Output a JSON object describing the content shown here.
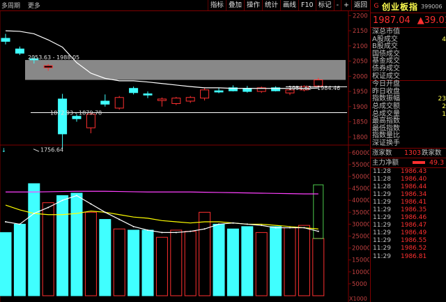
{
  "header": {
    "period_label": "多周期",
    "more_label": "更多",
    "toolbar": [
      "指标",
      "叠加",
      "操作",
      "统计",
      "画线",
      "F10",
      "标记",
      "-",
      "+",
      "返回"
    ]
  },
  "stock": {
    "market_flag": "G",
    "name": "创业板指",
    "code": "399006",
    "price": "1987.04",
    "change": "▲39.01"
  },
  "stats": [
    "深总市值",
    "A股成交",
    "B股成交",
    "国债成交",
    "基金成交",
    "债券成交",
    "权证成交",
    "今日开盘",
    "昨日收盘",
    "指数振幅",
    "总成交额",
    "总成交量",
    "最高指数",
    "最低指数",
    "指数量比",
    "深证换手"
  ],
  "stat_values": {
    "A股成交": "4",
    "指数振幅": "23",
    "总成交额": "2",
    "总成交量": "1"
  },
  "updown": {
    "up_label": "涨家数",
    "up_count": "1303",
    "down_label": "跌家数"
  },
  "mainflow": {
    "label": "主力净额",
    "value": "49.3"
  },
  "ticks": [
    {
      "t": "11:28",
      "p": "1986.43"
    },
    {
      "t": "11:28",
      "p": "1986.40"
    },
    {
      "t": "11:28",
      "p": "1986.44"
    },
    {
      "t": "11:29",
      "p": "1986.34"
    },
    {
      "t": "11:29",
      "p": "1986.41"
    },
    {
      "t": "11:29",
      "p": "1986.35"
    },
    {
      "t": "11:29",
      "p": "1986.46"
    },
    {
      "t": "11:29",
      "p": "1986.47"
    },
    {
      "t": "11:29",
      "p": "1986.49"
    },
    {
      "t": "11:29",
      "p": "1986.55"
    },
    {
      "t": "11:29",
      "p": "1986.52"
    },
    {
      "t": "11:29",
      "p": "1986.81"
    }
  ],
  "price_axis": {
    "ticks": [
      "2200",
      "2150",
      "2100",
      "2050",
      "2000",
      "1950",
      "1900",
      "1850",
      "1800"
    ],
    "values": [
      2200,
      2150,
      2100,
      2050,
      2000,
      1950,
      1900,
      1850,
      1800
    ]
  },
  "volume_axis": {
    "ticks": [
      "60000",
      "55000",
      "50000",
      "45000",
      "40000",
      "35000",
      "30000",
      "25000",
      "20000",
      "15000",
      "10000",
      "5000"
    ],
    "values": [
      60000,
      55000,
      50000,
      45000,
      40000,
      35000,
      30000,
      25000,
      20000,
      15000,
      10000,
      5000
    ],
    "unit": "X1000"
  },
  "annotations": {
    "high": "2053.63 - 1988.05",
    "mid1": "1872.93 - 1879.78",
    "mid2": "1954.62 - 1984.46",
    "low": "1756.64"
  },
  "chart_data": {
    "type": "candlestick",
    "ylim": [
      1780,
      2210
    ],
    "vol_ylim": [
      0,
      62000
    ],
    "colors": {
      "up": "#ff3030",
      "down": "#40ffff",
      "ma1": "#ffffff",
      "ma2": "#ffff00",
      "ma3": "#ff40ff",
      "band": "#a0a0a0"
    },
    "candles": [
      {
        "o": 2125,
        "h": 2140,
        "l": 2105,
        "c": 2115
      },
      {
        "o": 2090,
        "h": 2098,
        "l": 2070,
        "c": 2076
      },
      {
        "o": 2058,
        "h": 2066,
        "l": 2042,
        "c": 2054
      },
      {
        "o": 2028,
        "h": 2040,
        "l": 2018,
        "c": 2035
      },
      {
        "o": 1925,
        "h": 1942,
        "l": 1760,
        "c": 1810
      },
      {
        "o": 1868,
        "h": 1875,
        "l": 1850,
        "c": 1860
      },
      {
        "o": 1830,
        "h": 1880,
        "l": 1812,
        "c": 1875
      },
      {
        "o": 1918,
        "h": 1940,
        "l": 1900,
        "c": 1908
      },
      {
        "o": 1895,
        "h": 1935,
        "l": 1890,
        "c": 1930
      },
      {
        "o": 1960,
        "h": 1966,
        "l": 1940,
        "c": 1946
      },
      {
        "o": 1942,
        "h": 1950,
        "l": 1928,
        "c": 1938
      },
      {
        "o": 1920,
        "h": 1930,
        "l": 1900,
        "c": 1925
      },
      {
        "o": 1910,
        "h": 1932,
        "l": 1905,
        "c": 1928
      },
      {
        "o": 1918,
        "h": 1935,
        "l": 1912,
        "c": 1930
      },
      {
        "o": 1928,
        "h": 1962,
        "l": 1920,
        "c": 1955
      },
      {
        "o": 1952,
        "h": 1962,
        "l": 1944,
        "c": 1948
      },
      {
        "o": 1962,
        "h": 1970,
        "l": 1950,
        "c": 1952
      },
      {
        "o": 1960,
        "h": 1968,
        "l": 1946,
        "c": 1950
      },
      {
        "o": 1950,
        "h": 1966,
        "l": 1945,
        "c": 1962
      },
      {
        "o": 1962,
        "h": 1967,
        "l": 1950,
        "c": 1952
      },
      {
        "o": 1945,
        "h": 1960,
        "l": 1938,
        "c": 1955
      },
      {
        "o": 1955,
        "h": 1970,
        "l": 1950,
        "c": 1966
      },
      {
        "o": 1968,
        "h": 1995,
        "l": 1966,
        "c": 1988
      }
    ],
    "volumes": [
      26500,
      30000,
      47000,
      39000,
      42000,
      43000,
      35000,
      32000,
      28000,
      27500,
      27500,
      24500,
      27500,
      27000,
      35000,
      30000,
      28000,
      29000,
      26500,
      29000,
      28500,
      29500,
      24000
    ],
    "ma_price": [
      2150,
      2148,
      2140,
      2120,
      2096,
      2045,
      2010,
      1993,
      1985,
      1985,
      1981,
      1976,
      1971,
      1966,
      1962,
      1962,
      1960,
      1960,
      1960,
      1960,
      1960,
      1960,
      1961
    ],
    "vol_ma1": [
      31000,
      30000,
      34500,
      37000,
      40000,
      42000,
      38500,
      35000,
      32000,
      29000,
      27500,
      26500,
      26500,
      27000,
      28000,
      30000,
      30500,
      30000,
      29500,
      28500,
      28500,
      28500,
      27000
    ],
    "vol_ma2": [
      38000,
      36000,
      34500,
      34000,
      34000,
      34500,
      35500,
      35000,
      34000,
      33000,
      32500,
      31500,
      31000,
      30500,
      31000,
      31000,
      30500,
      30000,
      30000,
      29500,
      29000,
      28500,
      28000
    ],
    "vol_ma3": [
      43500,
      43500,
      43500,
      43600,
      43700,
      43800,
      43800,
      43800,
      43700,
      43600,
      43500,
      43500,
      43500,
      43500,
      43400,
      43300,
      43200,
      43100,
      43000,
      42900,
      42800,
      42700,
      42700
    ]
  }
}
